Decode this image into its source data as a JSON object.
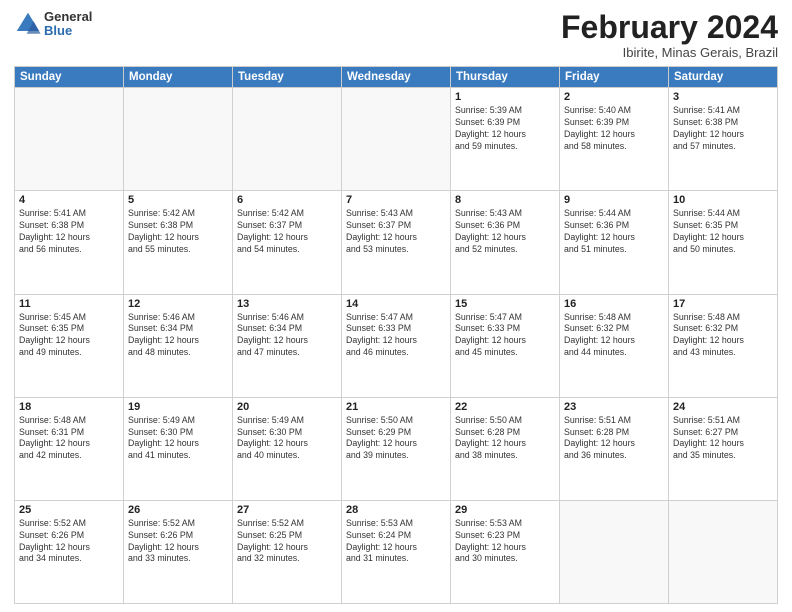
{
  "header": {
    "logo_general": "General",
    "logo_blue": "Blue",
    "month_title": "February 2024",
    "location": "Ibirite, Minas Gerais, Brazil"
  },
  "days_of_week": [
    "Sunday",
    "Monday",
    "Tuesday",
    "Wednesday",
    "Thursday",
    "Friday",
    "Saturday"
  ],
  "weeks": [
    [
      {
        "day": "",
        "content": ""
      },
      {
        "day": "",
        "content": ""
      },
      {
        "day": "",
        "content": ""
      },
      {
        "day": "",
        "content": ""
      },
      {
        "day": "1",
        "content": "Sunrise: 5:39 AM\nSunset: 6:39 PM\nDaylight: 12 hours\nand 59 minutes."
      },
      {
        "day": "2",
        "content": "Sunrise: 5:40 AM\nSunset: 6:39 PM\nDaylight: 12 hours\nand 58 minutes."
      },
      {
        "day": "3",
        "content": "Sunrise: 5:41 AM\nSunset: 6:38 PM\nDaylight: 12 hours\nand 57 minutes."
      }
    ],
    [
      {
        "day": "4",
        "content": "Sunrise: 5:41 AM\nSunset: 6:38 PM\nDaylight: 12 hours\nand 56 minutes."
      },
      {
        "day": "5",
        "content": "Sunrise: 5:42 AM\nSunset: 6:38 PM\nDaylight: 12 hours\nand 55 minutes."
      },
      {
        "day": "6",
        "content": "Sunrise: 5:42 AM\nSunset: 6:37 PM\nDaylight: 12 hours\nand 54 minutes."
      },
      {
        "day": "7",
        "content": "Sunrise: 5:43 AM\nSunset: 6:37 PM\nDaylight: 12 hours\nand 53 minutes."
      },
      {
        "day": "8",
        "content": "Sunrise: 5:43 AM\nSunset: 6:36 PM\nDaylight: 12 hours\nand 52 minutes."
      },
      {
        "day": "9",
        "content": "Sunrise: 5:44 AM\nSunset: 6:36 PM\nDaylight: 12 hours\nand 51 minutes."
      },
      {
        "day": "10",
        "content": "Sunrise: 5:44 AM\nSunset: 6:35 PM\nDaylight: 12 hours\nand 50 minutes."
      }
    ],
    [
      {
        "day": "11",
        "content": "Sunrise: 5:45 AM\nSunset: 6:35 PM\nDaylight: 12 hours\nand 49 minutes."
      },
      {
        "day": "12",
        "content": "Sunrise: 5:46 AM\nSunset: 6:34 PM\nDaylight: 12 hours\nand 48 minutes."
      },
      {
        "day": "13",
        "content": "Sunrise: 5:46 AM\nSunset: 6:34 PM\nDaylight: 12 hours\nand 47 minutes."
      },
      {
        "day": "14",
        "content": "Sunrise: 5:47 AM\nSunset: 6:33 PM\nDaylight: 12 hours\nand 46 minutes."
      },
      {
        "day": "15",
        "content": "Sunrise: 5:47 AM\nSunset: 6:33 PM\nDaylight: 12 hours\nand 45 minutes."
      },
      {
        "day": "16",
        "content": "Sunrise: 5:48 AM\nSunset: 6:32 PM\nDaylight: 12 hours\nand 44 minutes."
      },
      {
        "day": "17",
        "content": "Sunrise: 5:48 AM\nSunset: 6:32 PM\nDaylight: 12 hours\nand 43 minutes."
      }
    ],
    [
      {
        "day": "18",
        "content": "Sunrise: 5:48 AM\nSunset: 6:31 PM\nDaylight: 12 hours\nand 42 minutes."
      },
      {
        "day": "19",
        "content": "Sunrise: 5:49 AM\nSunset: 6:30 PM\nDaylight: 12 hours\nand 41 minutes."
      },
      {
        "day": "20",
        "content": "Sunrise: 5:49 AM\nSunset: 6:30 PM\nDaylight: 12 hours\nand 40 minutes."
      },
      {
        "day": "21",
        "content": "Sunrise: 5:50 AM\nSunset: 6:29 PM\nDaylight: 12 hours\nand 39 minutes."
      },
      {
        "day": "22",
        "content": "Sunrise: 5:50 AM\nSunset: 6:28 PM\nDaylight: 12 hours\nand 38 minutes."
      },
      {
        "day": "23",
        "content": "Sunrise: 5:51 AM\nSunset: 6:28 PM\nDaylight: 12 hours\nand 36 minutes."
      },
      {
        "day": "24",
        "content": "Sunrise: 5:51 AM\nSunset: 6:27 PM\nDaylight: 12 hours\nand 35 minutes."
      }
    ],
    [
      {
        "day": "25",
        "content": "Sunrise: 5:52 AM\nSunset: 6:26 PM\nDaylight: 12 hours\nand 34 minutes."
      },
      {
        "day": "26",
        "content": "Sunrise: 5:52 AM\nSunset: 6:26 PM\nDaylight: 12 hours\nand 33 minutes."
      },
      {
        "day": "27",
        "content": "Sunrise: 5:52 AM\nSunset: 6:25 PM\nDaylight: 12 hours\nand 32 minutes."
      },
      {
        "day": "28",
        "content": "Sunrise: 5:53 AM\nSunset: 6:24 PM\nDaylight: 12 hours\nand 31 minutes."
      },
      {
        "day": "29",
        "content": "Sunrise: 5:53 AM\nSunset: 6:23 PM\nDaylight: 12 hours\nand 30 minutes."
      },
      {
        "day": "",
        "content": ""
      },
      {
        "day": "",
        "content": ""
      }
    ]
  ]
}
